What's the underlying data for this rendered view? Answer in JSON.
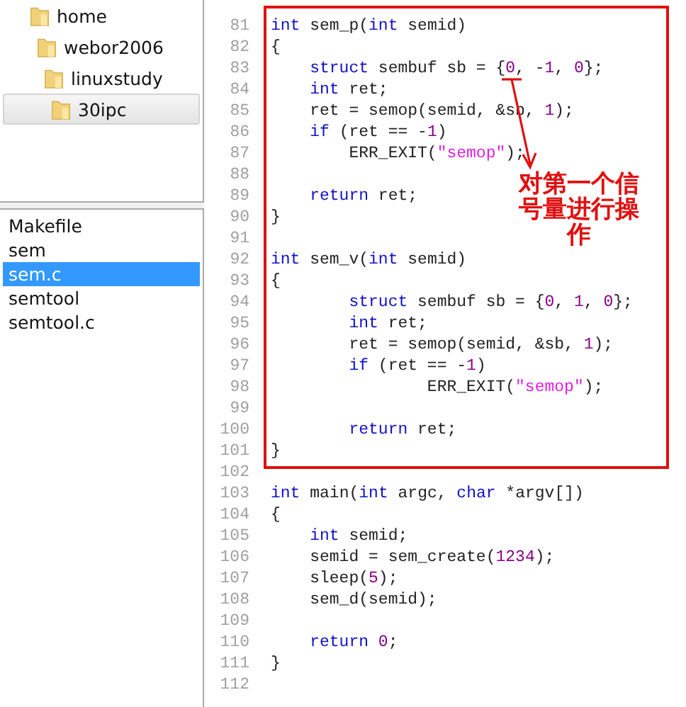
{
  "tree": {
    "items": [
      {
        "label": "home",
        "selected": false,
        "children": [
          {
            "label": "webor2006",
            "selected": false,
            "children": [
              {
                "label": "linuxstudy",
                "selected": false,
                "children": [
                  {
                    "label": "30ipc",
                    "selected": true
                  }
                ]
              }
            ]
          }
        ]
      }
    ]
  },
  "files": [
    {
      "label": "Makefile",
      "selected": false
    },
    {
      "label": "sem",
      "selected": false
    },
    {
      "label": "sem.c",
      "selected": true
    },
    {
      "label": "semtool",
      "selected": false
    },
    {
      "label": "semtool.c",
      "selected": false
    }
  ],
  "code": {
    "lines": [
      {
        "number": "81",
        "tokens": [
          {
            "kind": "kw",
            "text": "int"
          },
          {
            "kind": "plain",
            "text": " sem_p("
          },
          {
            "kind": "kw",
            "text": "int"
          },
          {
            "kind": "plain",
            "text": " semid)"
          }
        ]
      },
      {
        "number": "82",
        "tokens": [
          {
            "kind": "plain",
            "text": "{"
          }
        ]
      },
      {
        "number": "83",
        "tokens": [
          {
            "kind": "kw",
            "text": "    struct"
          },
          {
            "kind": "plain",
            "text": " sembuf sb = {"
          },
          {
            "kind": "num",
            "text": "0"
          },
          {
            "kind": "plain",
            "text": ", -"
          },
          {
            "kind": "num",
            "text": "1"
          },
          {
            "kind": "plain",
            "text": ", "
          },
          {
            "kind": "num",
            "text": "0"
          },
          {
            "kind": "plain",
            "text": "};"
          }
        ]
      },
      {
        "number": "84",
        "tokens": [
          {
            "kind": "kw",
            "text": "    int"
          },
          {
            "kind": "plain",
            "text": " ret;"
          }
        ]
      },
      {
        "number": "85",
        "tokens": [
          {
            "kind": "plain",
            "text": "    ret = semop(semid, &sb, "
          },
          {
            "kind": "num",
            "text": "1"
          },
          {
            "kind": "plain",
            "text": ");"
          }
        ]
      },
      {
        "number": "86",
        "tokens": [
          {
            "kind": "kw",
            "text": "    if"
          },
          {
            "kind": "plain",
            "text": " (ret == -"
          },
          {
            "kind": "num",
            "text": "1"
          },
          {
            "kind": "plain",
            "text": ")"
          }
        ]
      },
      {
        "number": "87",
        "tokens": [
          {
            "kind": "plain",
            "text": "        ERR_EXIT("
          },
          {
            "kind": "str",
            "text": "\"semop\""
          },
          {
            "kind": "plain",
            "text": ");"
          }
        ]
      },
      {
        "number": "88"
      },
      {
        "number": "89",
        "tokens": [
          {
            "kind": "kw",
            "text": "    return"
          },
          {
            "kind": "plain",
            "text": " ret;"
          }
        ]
      },
      {
        "number": "90",
        "tokens": [
          {
            "kind": "plain",
            "text": "}"
          }
        ]
      },
      {
        "number": "91"
      },
      {
        "number": "92",
        "tokens": [
          {
            "kind": "kw",
            "text": "int"
          },
          {
            "kind": "plain",
            "text": " sem_v("
          },
          {
            "kind": "kw",
            "text": "int"
          },
          {
            "kind": "plain",
            "text": " semid)"
          }
        ]
      },
      {
        "number": "93",
        "tokens": [
          {
            "kind": "plain",
            "text": "{"
          }
        ]
      },
      {
        "number": "94",
        "tokens": [
          {
            "kind": "kw",
            "text": "        struct"
          },
          {
            "kind": "plain",
            "text": " sembuf sb = {"
          },
          {
            "kind": "num",
            "text": "0"
          },
          {
            "kind": "plain",
            "text": ", "
          },
          {
            "kind": "num",
            "text": "1"
          },
          {
            "kind": "plain",
            "text": ", "
          },
          {
            "kind": "num",
            "text": "0"
          },
          {
            "kind": "plain",
            "text": "};"
          }
        ]
      },
      {
        "number": "95",
        "tokens": [
          {
            "kind": "kw",
            "text": "        int"
          },
          {
            "kind": "plain",
            "text": " ret;"
          }
        ]
      },
      {
        "number": "96",
        "tokens": [
          {
            "kind": "plain",
            "text": "        ret = semop(semid, &sb, "
          },
          {
            "kind": "num",
            "text": "1"
          },
          {
            "kind": "plain",
            "text": ");"
          }
        ]
      },
      {
        "number": "97",
        "tokens": [
          {
            "kind": "kw",
            "text": "        if"
          },
          {
            "kind": "plain",
            "text": " (ret == -"
          },
          {
            "kind": "num",
            "text": "1"
          },
          {
            "kind": "plain",
            "text": ")"
          }
        ]
      },
      {
        "number": "98",
        "tokens": [
          {
            "kind": "plain",
            "text": "                ERR_EXIT("
          },
          {
            "kind": "str",
            "text": "\"semop\""
          },
          {
            "kind": "plain",
            "text": ");"
          }
        ]
      },
      {
        "number": "99"
      },
      {
        "number": "100",
        "tokens": [
          {
            "kind": "kw",
            "text": "        return"
          },
          {
            "kind": "plain",
            "text": " ret;"
          }
        ]
      },
      {
        "number": "101",
        "tokens": [
          {
            "kind": "plain",
            "text": "}"
          }
        ]
      },
      {
        "number": "102"
      },
      {
        "number": "103",
        "tokens": [
          {
            "kind": "kw",
            "text": "int"
          },
          {
            "kind": "plain",
            "text": " main("
          },
          {
            "kind": "kw",
            "text": "int"
          },
          {
            "kind": "plain",
            "text": " argc, "
          },
          {
            "kind": "kw",
            "text": "char"
          },
          {
            "kind": "plain",
            "text": " *argv[])"
          }
        ]
      },
      {
        "number": "104",
        "tokens": [
          {
            "kind": "plain",
            "text": "{"
          }
        ]
      },
      {
        "number": "105",
        "tokens": [
          {
            "kind": "kw",
            "text": "    int"
          },
          {
            "kind": "plain",
            "text": " semid;"
          }
        ]
      },
      {
        "number": "106",
        "tokens": [
          {
            "kind": "plain",
            "text": "    semid = sem_create("
          },
          {
            "kind": "num",
            "text": "1234"
          },
          {
            "kind": "plain",
            "text": ");"
          }
        ]
      },
      {
        "number": "107",
        "tokens": [
          {
            "kind": "plain",
            "text": "    sleep("
          },
          {
            "kind": "num",
            "text": "5"
          },
          {
            "kind": "plain",
            "text": ");"
          }
        ]
      },
      {
        "number": "108",
        "tokens": [
          {
            "kind": "plain",
            "text": "    sem_d(semid);"
          }
        ]
      },
      {
        "number": "109"
      },
      {
        "number": "110",
        "tokens": [
          {
            "kind": "kw",
            "text": "    return "
          },
          {
            "kind": "num",
            "text": "0"
          },
          {
            "kind": "plain",
            "text": ";"
          }
        ]
      },
      {
        "number": "111",
        "tokens": [
          {
            "kind": "plain",
            "text": "}"
          }
        ]
      },
      {
        "number": "112"
      }
    ]
  },
  "annotation": {
    "text": "对第一个信号量进行操作"
  }
}
